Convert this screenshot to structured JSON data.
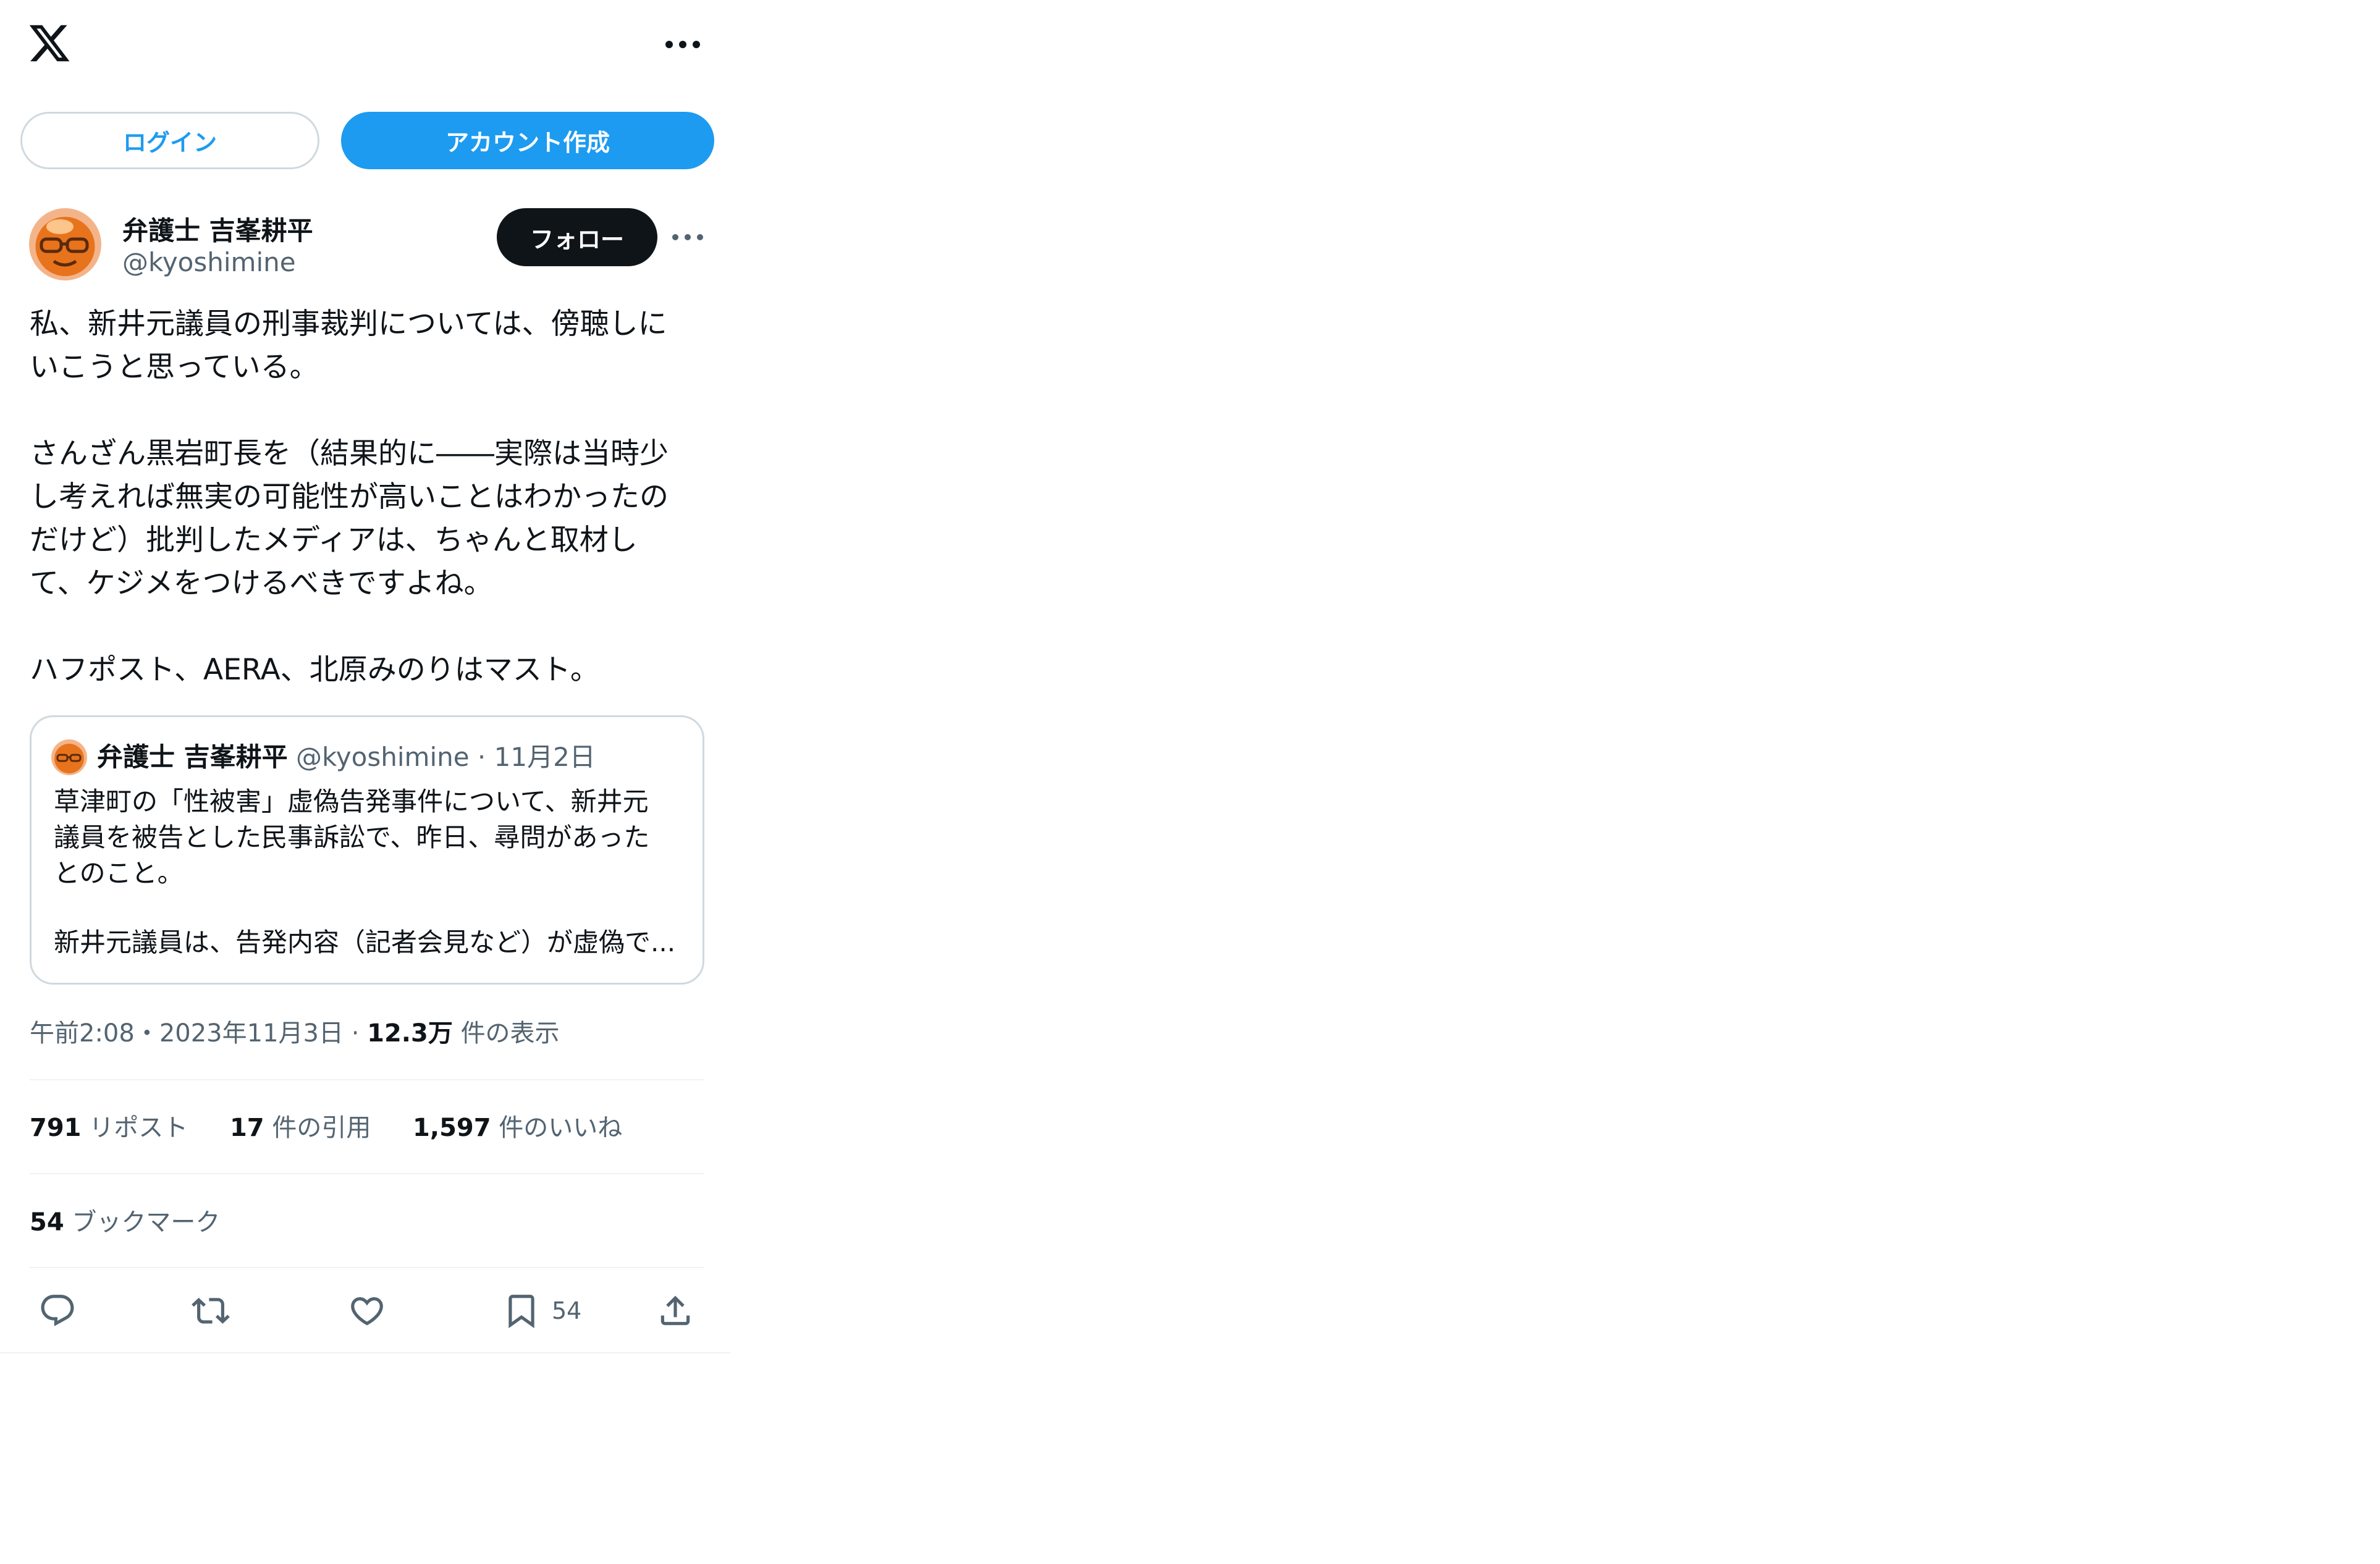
{
  "header": {
    "logo_icon": "x-logo-icon",
    "more_icon": "more-horizontal-icon"
  },
  "auth": {
    "login_label": "ログイン",
    "signup_label": "アカウント作成"
  },
  "tweet": {
    "author_name": "弁護士 吉峯耕平",
    "author_handle": "@kyoshimine",
    "follow_label": "フォロー",
    "text": "私、新井元議員の刑事裁判については、傍聴しに\nいこうと思っている。\n\nさんざん黒岩町長を（結果的に――実際は当時少\nし考えれば無実の可能性が高いことはわかったの\nだけど）批判したメディアは、ちゃんと取材し\nて、ケジメをつけるべきですよね。\n\nハフポスト、AERA、北原みのりはマスト。",
    "time": "午前2:08",
    "date": "2023年11月3日",
    "views": "12.3万",
    "views_label": "件の表示",
    "sep": "・",
    "sep2": " · "
  },
  "quote": {
    "author_name": "弁護士 吉峯耕平",
    "author_handle": "@kyoshimine",
    "date": "11月2日",
    "dot": " · ",
    "text": "草津町の「性被害」虚偽告発事件について、新井元\n議員を被告とした民事訴訟で、昨日、尋問があった\nとのこと。",
    "text_last": "新井元議員は、告発内容（記者会見など）が虚偽で..."
  },
  "stats": {
    "retweets": "791",
    "retweets_label": "リポスト",
    "quotes": "17",
    "quotes_label": "件の引用",
    "likes": "1,597",
    "likes_label": "件のいいね",
    "bookmarks": "54",
    "bookmarks_label": "ブックマーク"
  },
  "actions": {
    "reply_icon": "reply-icon",
    "retweet_icon": "retweet-icon",
    "like_icon": "heart-icon",
    "bookmark_icon": "bookmark-icon",
    "bookmark_count": "54",
    "share_icon": "share-icon"
  },
  "colors": {
    "accent": "#1d9bf0",
    "text": "#0f1419",
    "secondary": "#536471",
    "border": "#cfd9de"
  }
}
